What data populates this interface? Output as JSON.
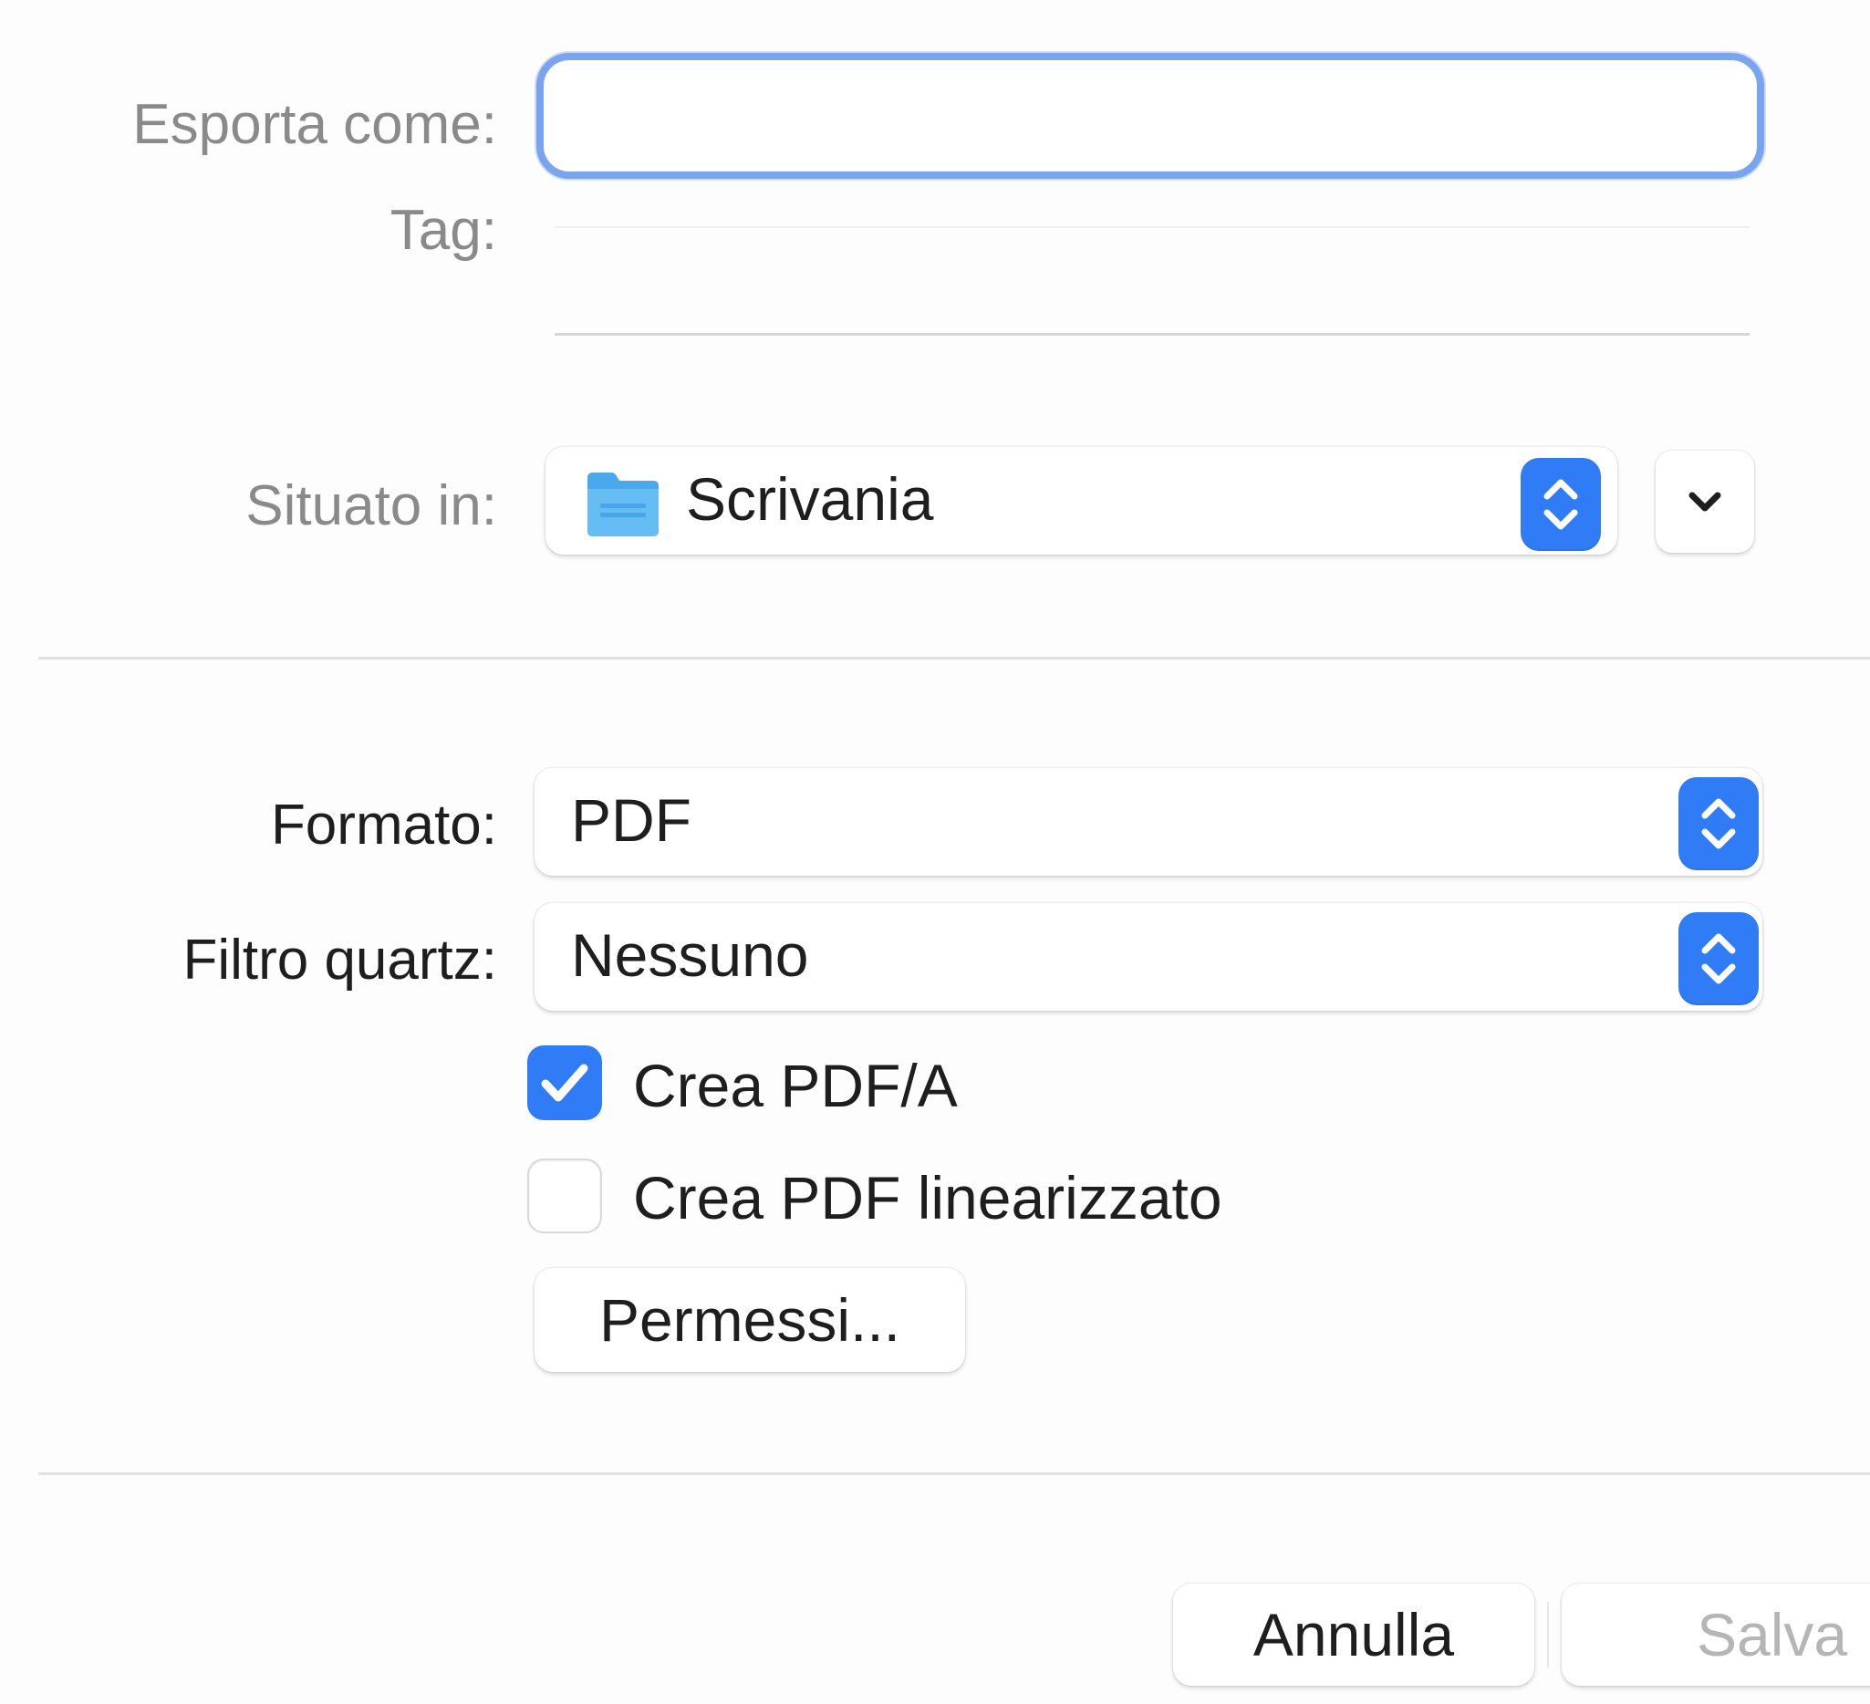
{
  "dialog": {
    "export_as": {
      "label": "Esporta come:",
      "value": "",
      "placeholder": ""
    },
    "tags": {
      "label": "Tag:",
      "value": ""
    },
    "location": {
      "label": "Situato in:",
      "value": "Scrivania",
      "icon": "folder-icon"
    },
    "format": {
      "label": "Formato:",
      "value": "PDF"
    },
    "quartz_filter": {
      "label": "Filtro quartz:",
      "value": "Nessuno"
    },
    "options": [
      {
        "label": "Crea PDF/A",
        "checked": true
      },
      {
        "label": "Crea PDF linearizzato",
        "checked": false
      }
    ],
    "permissions_button": "Permessi...",
    "cancel_button": "Annulla",
    "save_button": "Salva"
  },
  "colors": {
    "accent": "#2f7cf6",
    "focus_ring": "#7aa4ee",
    "folder": "#5ab4f0",
    "disabled_text": "#b5b5b5"
  }
}
